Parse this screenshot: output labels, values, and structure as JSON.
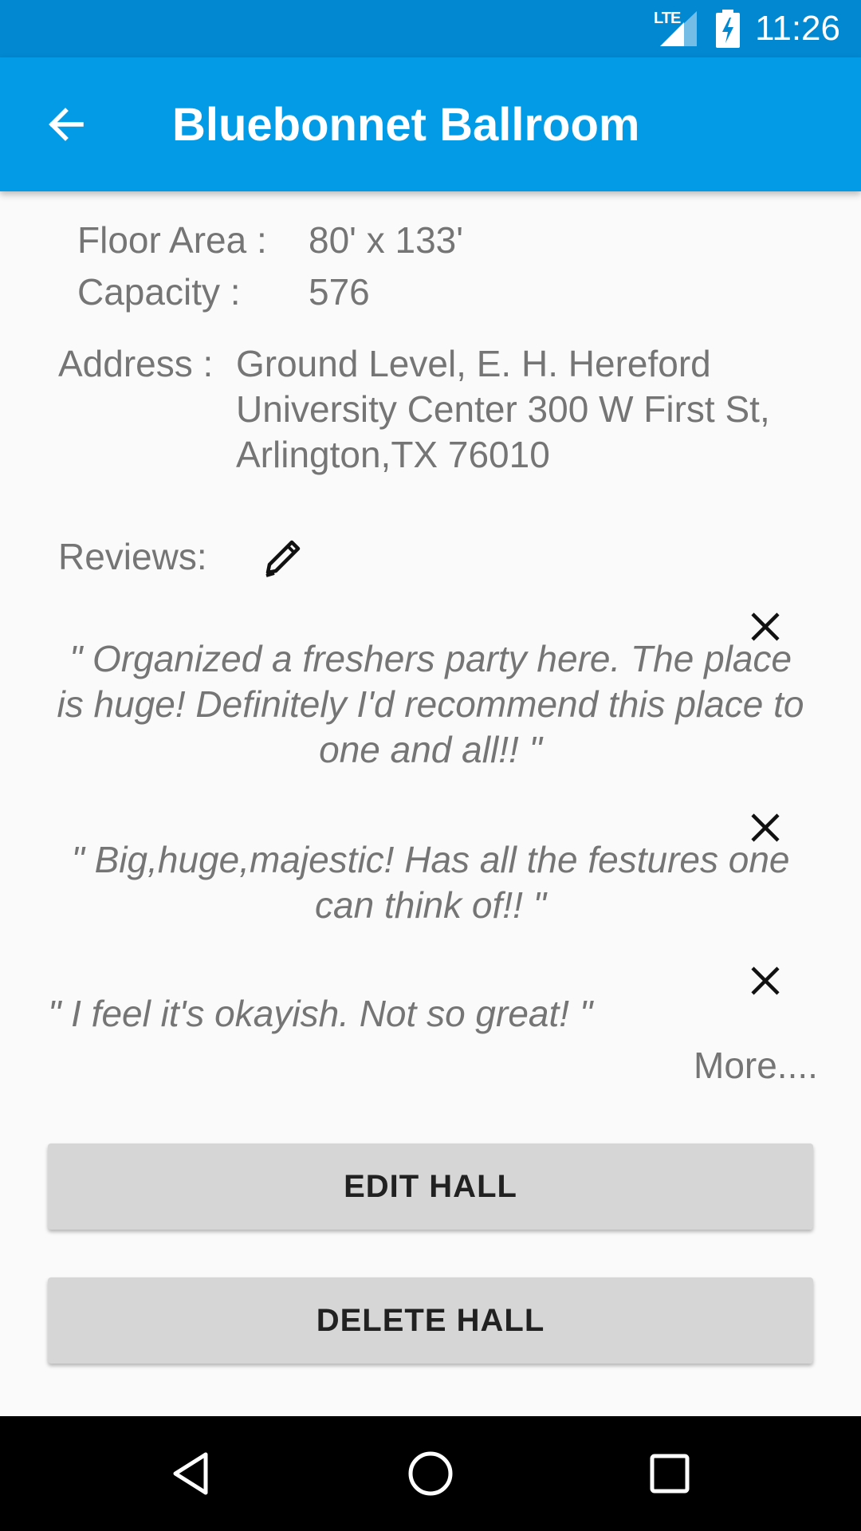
{
  "status_bar": {
    "time": "11:26",
    "network": "LTE",
    "icons": [
      "lte-signal-icon",
      "battery-charging-icon"
    ]
  },
  "app_bar": {
    "back_icon": "arrow-back-icon",
    "title": "Bluebonnet Ballroom",
    "color": "#039be5",
    "status_color": "#0288d1"
  },
  "details": {
    "floor_area_label": "Floor Area :",
    "floor_area_value": "80' x 133'",
    "capacity_label": "Capacity :",
    "capacity_value": "576",
    "address_label": "Address :",
    "address_lines": [
      "Ground Level, E. H. Hereford",
      "University Center 300 W First St,",
      "Arlington,TX 76010"
    ]
  },
  "reviews": {
    "label": "Reviews:",
    "edit_icon": "pencil-icon",
    "close_icon": "close-icon",
    "items": [
      {
        "lines": [
          "\" Organized a freshers party here. The place",
          "is huge! Definitely I'd recommend this place to",
          "one and all!!  \""
        ]
      },
      {
        "lines": [
          "\" Big,huge,majestic! Has all the festures one",
          "can think of!!  \""
        ]
      },
      {
        "lines": [
          "\" I feel it's okayish. Not so great!  \""
        ]
      }
    ],
    "more_link": "More...."
  },
  "actions": {
    "edit_label": "EDIT HALL",
    "delete_label": "DELETE HALL"
  },
  "nav_bar": {
    "icons": [
      "back-triangle-icon",
      "home-circle-icon",
      "recents-square-icon"
    ]
  }
}
